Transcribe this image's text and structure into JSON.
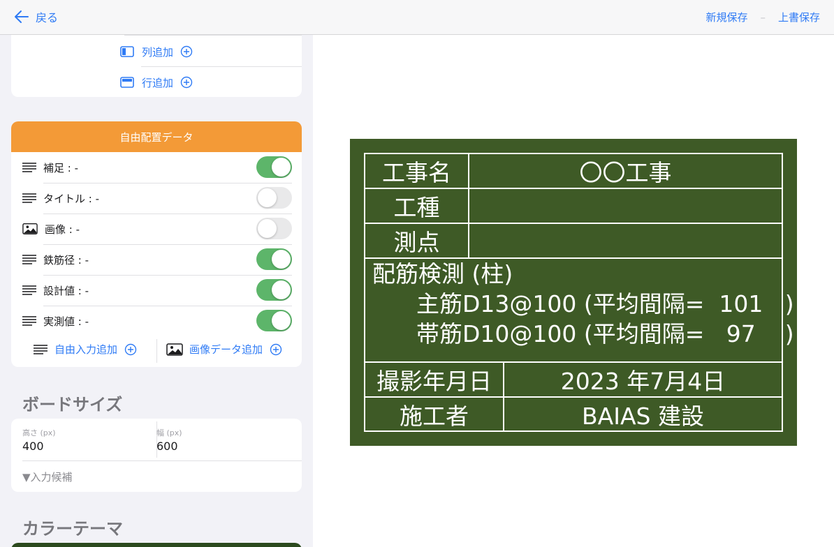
{
  "topbar": {
    "back_label": "戻る",
    "new_save": "新規保存",
    "separator": "–",
    "overwrite_save": "上書保存"
  },
  "layout_card": {
    "add_column": "列追加",
    "add_row": "行追加"
  },
  "free_data": {
    "header": "自由配置データ",
    "items": [
      {
        "label": "補足 : -",
        "icon": "text-lines-icon",
        "on": true
      },
      {
        "label": "タイトル : -",
        "icon": "text-lines-icon",
        "on": false
      },
      {
        "label": "画像 : -",
        "icon": "image-icon",
        "on": false
      },
      {
        "label": "鉄筋径 : -",
        "icon": "text-lines-icon",
        "on": true
      },
      {
        "label": "設計値 : -",
        "icon": "text-lines-icon",
        "on": true
      },
      {
        "label": "実測値 : -",
        "icon": "text-lines-icon",
        "on": true
      }
    ],
    "add_free_input": "自由入力追加",
    "add_image_data": "画像データ追加"
  },
  "board_size": {
    "title": "ボードサイズ",
    "height_label": "高さ (px)",
    "height_value": "400",
    "width_label": "幅 (px)",
    "width_value": "600",
    "candidates": "▼入力候補"
  },
  "color_theme": {
    "title": "カラーテーマ",
    "selected_color": "#2c4a1e"
  },
  "blackboard": {
    "background": "#3e5a26",
    "rows": [
      {
        "key": "工事名",
        "value": "〇〇工事"
      },
      {
        "key": "工種",
        "value": ""
      },
      {
        "key": "測点",
        "value": ""
      }
    ],
    "notes": [
      "配筋検測 (柱)",
      "      主筋D13@100 (平均間隔=  101   )",
      "      帯筋D10@100 (平均間隔=   97    )"
    ],
    "date_key": "撮影年月日",
    "date_value": "2023 年7月4日",
    "builder_key": "施工者",
    "builder_value": "BAIAS 建設"
  }
}
